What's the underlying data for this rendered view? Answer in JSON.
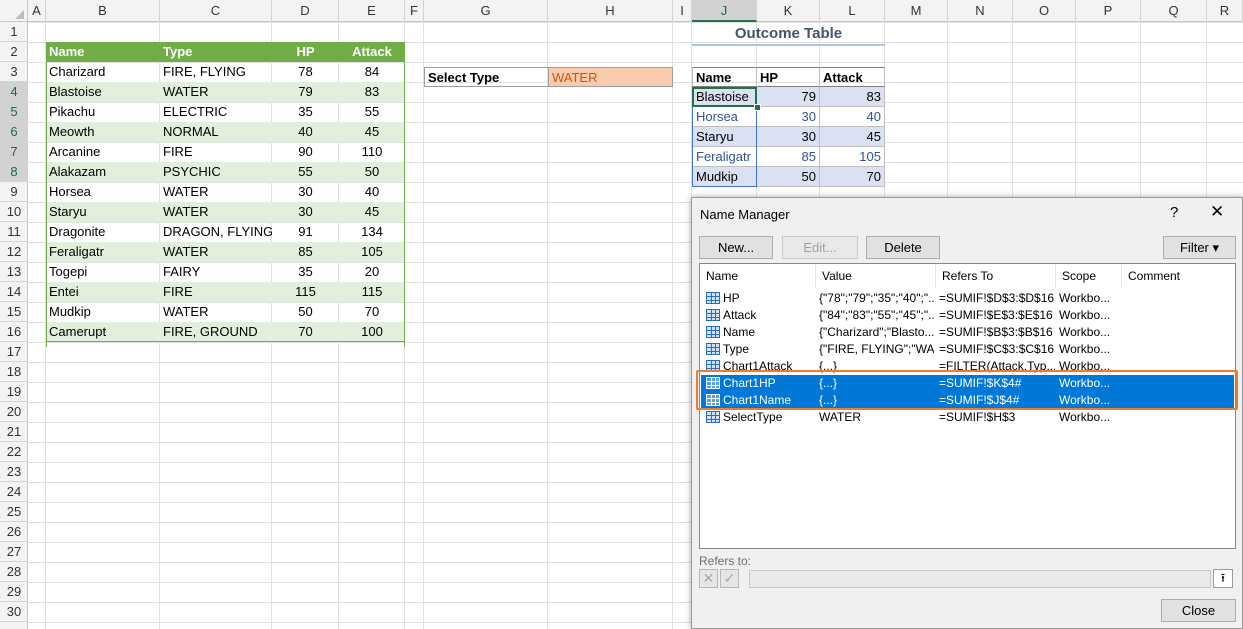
{
  "columns": [
    "A",
    "B",
    "C",
    "D",
    "E",
    "F",
    "G",
    "H",
    "I",
    "J",
    "K",
    "L",
    "M",
    "N",
    "O",
    "P",
    "Q",
    "R"
  ],
  "rows": [
    "1",
    "2",
    "3",
    "4",
    "5",
    "6",
    "7",
    "8",
    "9",
    "10",
    "11",
    "12",
    "13",
    "14",
    "15",
    "16",
    "17",
    "18",
    "19",
    "20",
    "21",
    "22",
    "23",
    "24",
    "25",
    "26",
    "27",
    "28",
    "29",
    "30"
  ],
  "source_table": {
    "headers": [
      "Name",
      "Type",
      "HP",
      "Attack"
    ],
    "rows": [
      [
        "Charizard",
        "FIRE, FLYING",
        "78",
        "84"
      ],
      [
        "Blastoise",
        "WATER",
        "79",
        "83"
      ],
      [
        "Pikachu",
        "ELECTRIC",
        "35",
        "55"
      ],
      [
        "Meowth",
        "NORMAL",
        "40",
        "45"
      ],
      [
        "Arcanine",
        "FIRE",
        "90",
        "110"
      ],
      [
        "Alakazam",
        "PSYCHIC",
        "55",
        "50"
      ],
      [
        "Horsea",
        "WATER",
        "30",
        "40"
      ],
      [
        "Staryu",
        "WATER",
        "30",
        "45"
      ],
      [
        "Dragonite",
        "DRAGON, FLYING",
        "91",
        "134"
      ],
      [
        "Feraligatr",
        "WATER",
        "85",
        "105"
      ],
      [
        "Togepi",
        "FAIRY",
        "35",
        "20"
      ],
      [
        "Entei",
        "FIRE",
        "115",
        "115"
      ],
      [
        "Mudkip",
        "WATER",
        "50",
        "70"
      ],
      [
        "Camerupt",
        "FIRE, GROUND",
        "70",
        "100"
      ]
    ]
  },
  "select_type": {
    "label": "Select Type",
    "value": "WATER"
  },
  "outcome": {
    "title": "Outcome Table",
    "headers": [
      "Name",
      "HP",
      "Attack"
    ],
    "rows": [
      [
        "Blastoise",
        "79",
        "83"
      ],
      [
        "Horsea",
        "30",
        "40"
      ],
      [
        "Staryu",
        "30",
        "45"
      ],
      [
        "Feraligatr",
        "85",
        "105"
      ],
      [
        "Mudkip",
        "50",
        "70"
      ]
    ]
  },
  "dialog": {
    "title": "Name Manager",
    "help": "?",
    "close": "✕",
    "new_label": "New...",
    "edit_label": "Edit...",
    "delete_label": "Delete",
    "filter_label": "Filter ▾",
    "columns": [
      "Name",
      "Value",
      "Refers To",
      "Scope",
      "Comment"
    ],
    "names": [
      {
        "name": "HP",
        "value": "{\"78\";\"79\";\"35\";\"40\";\"...",
        "refers": "=SUMIF!$D$3:$D$16",
        "scope": "Workbo...",
        "comment": ""
      },
      {
        "name": "Attack",
        "value": "{\"84\";\"83\";\"55\";\"45\";\"...",
        "refers": "=SUMIF!$E$3:$E$16",
        "scope": "Workbo...",
        "comment": ""
      },
      {
        "name": "Name",
        "value": "{\"Charizard\";\"Blasto...",
        "refers": "=SUMIF!$B$3:$B$16",
        "scope": "Workbo...",
        "comment": ""
      },
      {
        "name": "Type",
        "value": "{\"FIRE, FLYING\";\"WA...",
        "refers": "=SUMIF!$C$3:$C$16",
        "scope": "Workbo...",
        "comment": ""
      },
      {
        "name": "Chart1Attack",
        "value": "{...}",
        "refers": "=FILTER(Attack,Typ...",
        "scope": "Workbo...",
        "comment": ""
      },
      {
        "name": "Chart1HP",
        "value": "{...}",
        "refers": "=SUMIF!$K$4#",
        "scope": "Workbo...",
        "comment": ""
      },
      {
        "name": "Chart1Name",
        "value": "{...}",
        "refers": "=SUMIF!$J$4#",
        "scope": "Workbo...",
        "comment": ""
      },
      {
        "name": "SelectType",
        "value": "WATER",
        "refers": "=SUMIF!$H$3",
        "scope": "Workbo...",
        "comment": ""
      }
    ],
    "refers_to_label": "Refers to:",
    "cancel_glyph": "✕",
    "accept_glyph": "✓",
    "collapse_glyph": "⭱",
    "close_label": "Close"
  },
  "colors": {
    "table_header": "#70ad47",
    "table_band": "#e2efda",
    "select_fill": "#f8cbad",
    "outcome_fill": "#d9e1f2",
    "selection_blue": "#0078d7",
    "highlight_orange": "#ed7d31"
  }
}
